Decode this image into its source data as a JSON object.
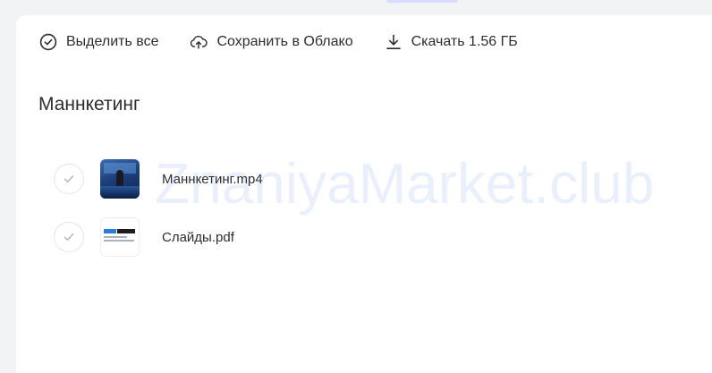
{
  "toolbar": {
    "select_all_label": "Выделить все",
    "save_cloud_label": "Сохранить в Облако",
    "download_label": "Скачать 1.56 ГБ"
  },
  "folder": {
    "title": "Маннкетинг"
  },
  "files": [
    {
      "name": "Маннкетинг.mp4",
      "thumb": "video-thumbnail"
    },
    {
      "name": "Слайды.pdf",
      "thumb": "pdf-thumbnail"
    }
  ],
  "watermark": "ZnaniyaMarket.club",
  "colors": {
    "background": "#f2f3f5",
    "panel": "#ffffff",
    "text": "#2c2d2e",
    "icon": "#2c2d2e",
    "check_border": "#e3e4e6",
    "watermark": "#3d7ee0"
  },
  "icons": {
    "select_all": "check-circle-icon",
    "save_cloud": "cloud-upload-icon",
    "download": "download-icon",
    "row_check": "checkmark-icon"
  }
}
